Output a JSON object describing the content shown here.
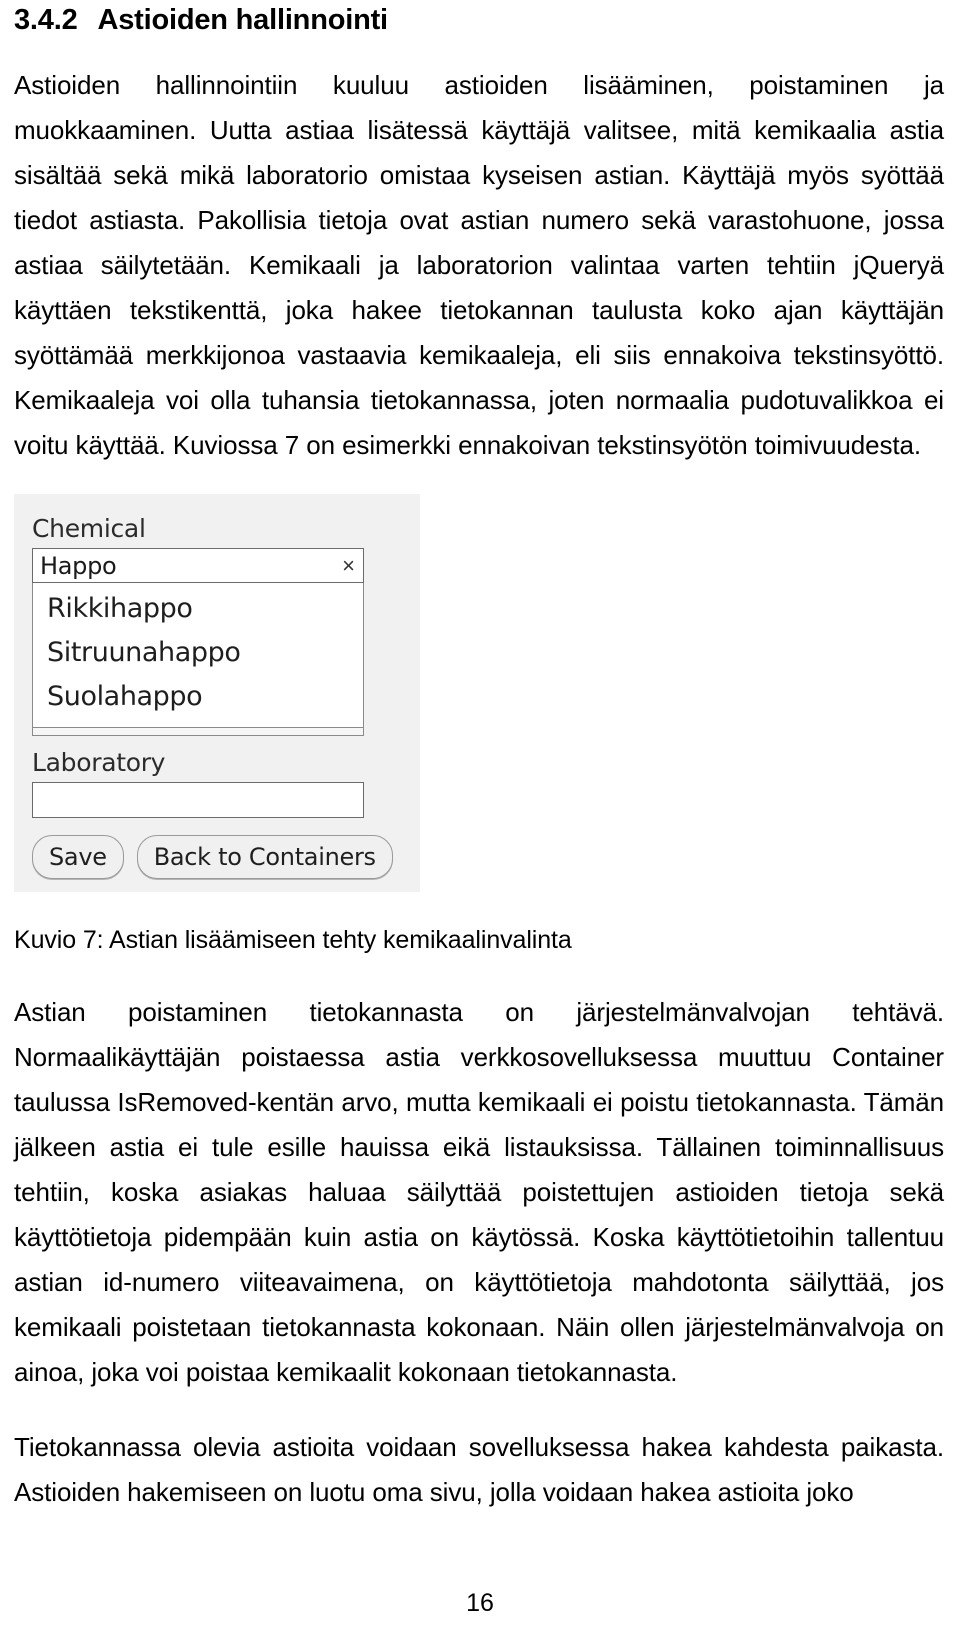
{
  "heading": {
    "number": "3.4.2",
    "title": "Astioiden hallinnointi"
  },
  "paragraphs": {
    "p1": "Astioiden hallinnointiin kuuluu astioiden lisääminen, poistaminen ja muokkaaminen. Uutta astiaa lisätessä käyttäjä valitsee, mitä kemikaalia astia sisältää sekä mikä laboratorio omistaa kyseisen astian. Käyttäjä myös syöttää tiedot astiasta. Pakollisia tietoja ovat astian numero sekä varastohuone, jossa astiaa säilytetään. Kemikaali ja laboratorion valintaa varten tehtiin jQueryä käyttäen tekstikenttä, joka hakee tietokannan taulusta koko ajan käyttäjän syöttämää merkkijonoa vastaavia kemikaaleja, eli siis ennakoiva tekstinsyöttö. Kemikaaleja voi olla tuhansia tietokannassa, joten normaalia pudotuvalikkoa ei voitu käyttää. Kuviossa 7 on esimerkki ennakoivan tekstinsyötön toimivuudesta.",
    "p2": "Astian poistaminen tietokannasta on järjestelmänvalvojan tehtävä. Normaalikäyttäjän poistaessa astia verkkosovelluksessa muuttuu Container taulussa IsRemoved-kentän arvo, mutta kemikaali ei poistu tietokannasta. Tämän jälkeen astia ei tule esille hauissa eikä listauksissa. Tällainen toiminnallisuus tehtiin, koska asiakas haluaa säilyttää poistettujen astioiden tietoja sekä käyttötietoja pidempään kuin astia on käytössä. Koska käyttötietoihin tallentuu astian id-numero viiteavaimena, on käyttötietoja mahdotonta säilyttää, jos kemikaali poistetaan tietokannasta kokonaan. Näin ollen järjestelmänvalvoja on ainoa, joka voi poistaa kemikaalit kokonaan tietokannasta.",
    "p3": "Tietokannassa olevia astioita voidaan sovelluksessa hakea kahdesta paikasta. Astioiden hakemiseen on luotu oma sivu, jolla voidaan hakea astioita joko"
  },
  "figure": {
    "caption": "Kuvio 7: Astian lisäämiseen tehty kemikaalinvalinta",
    "form": {
      "chemical_label": "Chemical",
      "chemical_value": "Happo",
      "clear_icon": "×",
      "suggestions": [
        "Rikkihappo",
        "Sitruunahappo",
        "Suolahappo"
      ],
      "laboratory_label": "Laboratory",
      "laboratory_value": "",
      "save_button": "Save",
      "back_button": "Back to Containers"
    }
  },
  "footer": {
    "page_number": "16"
  }
}
